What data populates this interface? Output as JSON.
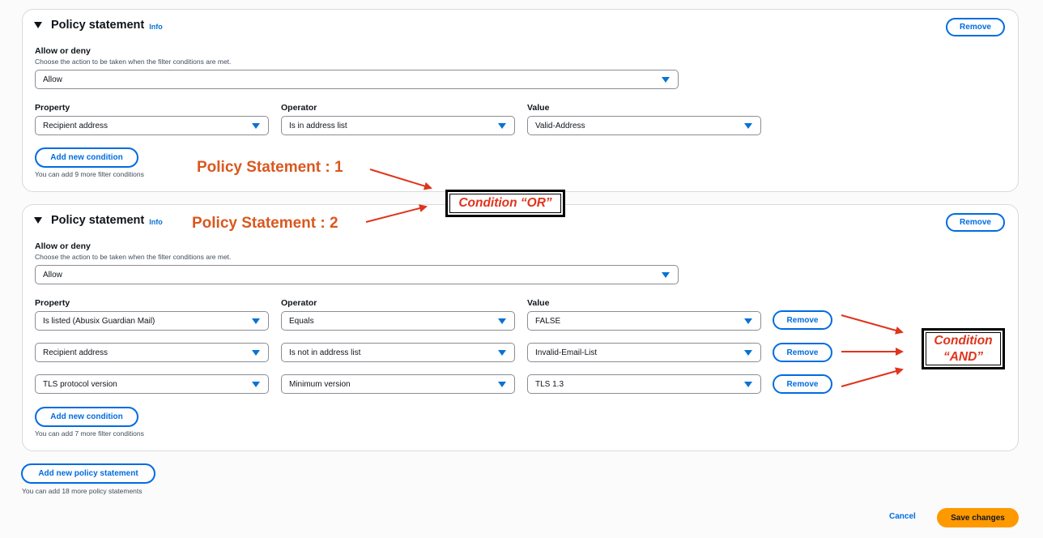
{
  "statements": [
    {
      "title": "Policy statement",
      "info": "Info",
      "remove_label": "Remove",
      "allow_deny": {
        "label": "Allow or deny",
        "description": "Choose the action to be taken when the filter conditions are met.",
        "value": "Allow"
      },
      "headers": {
        "property": "Property",
        "operator": "Operator",
        "value": "Value"
      },
      "conditions": [
        {
          "property": "Recipient address",
          "operator": "Is in address list",
          "value": "Valid-Address"
        }
      ],
      "add_condition_label": "Add new condition",
      "hint": "You can add 9 more filter conditions"
    },
    {
      "title": "Policy statement",
      "info": "Info",
      "remove_label": "Remove",
      "allow_deny": {
        "label": "Allow or deny",
        "description": "Choose the action to be taken when the filter conditions are met.",
        "value": "Allow"
      },
      "headers": {
        "property": "Property",
        "operator": "Operator",
        "value": "Value"
      },
      "conditions": [
        {
          "property": "Is listed (Abusix Guardian Mail)",
          "operator": "Equals",
          "value": "FALSE",
          "remove": "Remove"
        },
        {
          "property": "Recipient address",
          "operator": "Is not in address list",
          "value": "Invalid-Email-List",
          "remove": "Remove"
        },
        {
          "property": "TLS protocol version",
          "operator": "Minimum version",
          "value": "TLS 1.3",
          "remove": "Remove"
        }
      ],
      "add_condition_label": "Add new condition",
      "hint": "You can add 7 more filter conditions"
    }
  ],
  "add_policy_label": "Add new policy statement",
  "add_policy_hint": "You can add 18 more policy statements",
  "footer": {
    "cancel": "Cancel",
    "save": "Save changes"
  },
  "annotations": {
    "ps1": "Policy Statement : 1",
    "ps2": "Policy Statement : 2",
    "or_line": "Condition “OR”",
    "and_line1": "Condition",
    "and_line2": "“AND”"
  },
  "colors": {
    "accent": "#006ce0",
    "primary": "#ff9900",
    "annotation": "#d9581f",
    "condition": "#e0341c"
  }
}
